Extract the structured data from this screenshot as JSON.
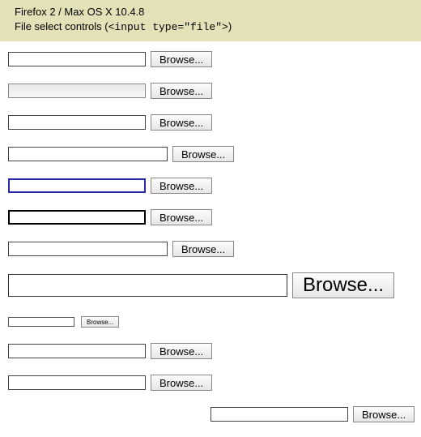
{
  "header": {
    "line1": "Firefox 2 / Max OS X 10.4.8",
    "line2_prefix": "File select controls (",
    "line2_code": "<input type=\"file\">",
    "line2_suffix": ")"
  },
  "browse_label": "Browse...",
  "rows": [
    {
      "id": "r1",
      "variant": "default"
    },
    {
      "id": "r2",
      "variant": "hover"
    },
    {
      "id": "r3",
      "variant": "default"
    },
    {
      "id": "r4",
      "variant": "wider"
    },
    {
      "id": "r5",
      "variant": "focus-blue"
    },
    {
      "id": "r6",
      "variant": "focus-black"
    },
    {
      "id": "r7",
      "variant": "wider"
    },
    {
      "id": "r8",
      "variant": "large"
    },
    {
      "id": "r9",
      "variant": "small"
    },
    {
      "id": "r10",
      "variant": "default"
    },
    {
      "id": "r11",
      "variant": "default"
    },
    {
      "id": "r12",
      "variant": "offset-right"
    }
  ]
}
